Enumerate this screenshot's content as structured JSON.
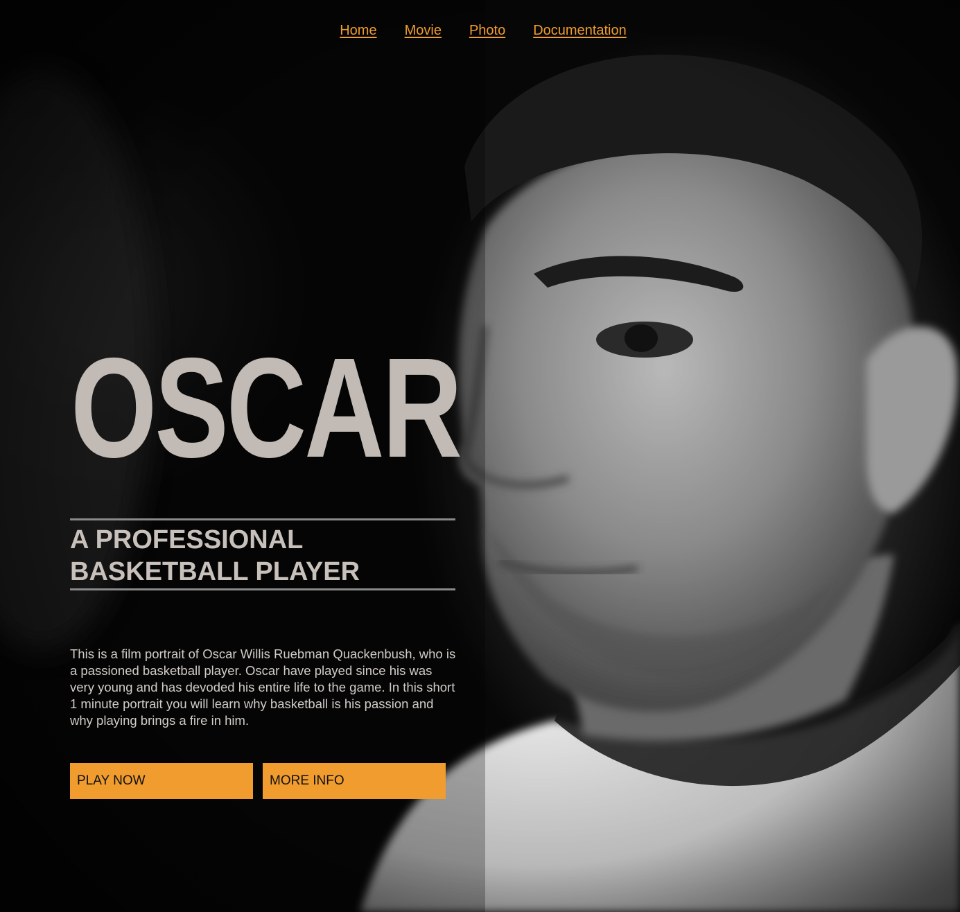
{
  "nav": {
    "items": [
      {
        "label": "Home"
      },
      {
        "label": "Movie"
      },
      {
        "label": "Photo"
      },
      {
        "label": "Documentation"
      }
    ]
  },
  "hero": {
    "title": "OSCAR",
    "subtitle": "A PROFESSIONAL BASKETBALL PLAYER",
    "description": "This is a film portrait of Oscar Willis Ruebman Quackenbush, who is a passioned basketball player. Oscar have played since his was very young and has devoded his entire life to the game. In this short 1 minute portrait you will learn why basketball is his passion and why playing brings a fire in him.",
    "play_label": "PLAY NOW",
    "info_label": "MORE INFO"
  },
  "colors": {
    "accent": "#f09c2e",
    "title": "#c1bab5",
    "background": "#0a0a0a"
  }
}
